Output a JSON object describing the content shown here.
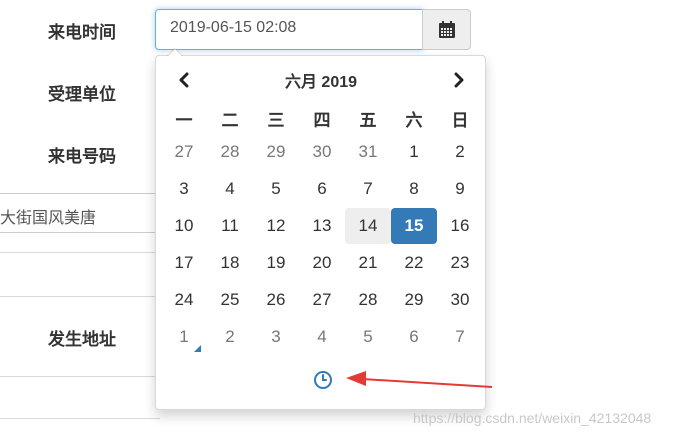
{
  "form": {
    "call_time_label": "来电时间",
    "unit_label": "受理单位",
    "phone_label": "来电号码",
    "address_label": "发生地址",
    "address_value": "大街国风美唐",
    "call_time_value": "2019-06-15 02:08"
  },
  "picker": {
    "month_title": "六月 2019",
    "weekdays": [
      "一",
      "二",
      "三",
      "四",
      "五",
      "六",
      "日"
    ],
    "weeks": [
      [
        "27",
        "28",
        "29",
        "30",
        "31",
        "1",
        "2"
      ],
      [
        "3",
        "4",
        "5",
        "6",
        "7",
        "8",
        "9"
      ],
      [
        "10",
        "11",
        "12",
        "13",
        "14",
        "15",
        "16"
      ],
      [
        "17",
        "18",
        "19",
        "20",
        "21",
        "22",
        "23"
      ],
      [
        "24",
        "25",
        "26",
        "27",
        "28",
        "29",
        "30"
      ],
      [
        "1",
        "2",
        "3",
        "4",
        "5",
        "6",
        "7"
      ]
    ],
    "today": "14",
    "selected": "15"
  },
  "colors": {
    "accent": "#337ab7",
    "arrow": "#e53935"
  },
  "icons": {
    "calendar": "calendar-icon",
    "prev": "chevron-left-icon",
    "next": "chevron-right-icon",
    "clock": "clock-icon"
  },
  "watermark": "https://blog.csdn.net/weixin_42132048"
}
